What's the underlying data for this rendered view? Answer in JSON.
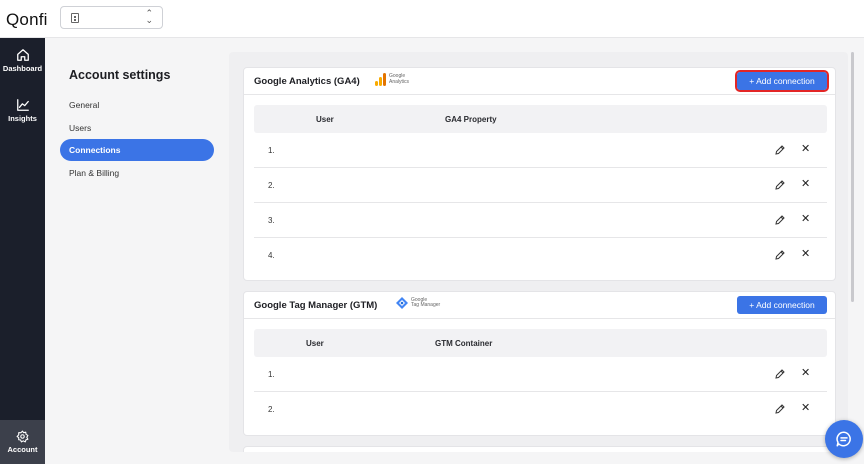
{
  "app": {
    "logo": "Qonfi"
  },
  "workspace_select": {
    "value": ""
  },
  "leftnav": {
    "items": [
      {
        "label": "Dashboard",
        "icon": "home-icon"
      },
      {
        "label": "Insights",
        "icon": "chart-line-icon"
      },
      {
        "label": "Account",
        "icon": "gear-icon",
        "active": true
      }
    ]
  },
  "settings": {
    "title": "Account settings",
    "items": [
      {
        "label": "General"
      },
      {
        "label": "Users"
      },
      {
        "label": "Connections",
        "active": true
      },
      {
        "label": "Plan & Billing"
      }
    ]
  },
  "ga4": {
    "title": "Google Analytics (GA4)",
    "brand_line1": "Google",
    "brand_line2": "Analytics",
    "add_label": "+ Add connection",
    "columns": [
      "User",
      "GA4 Property"
    ],
    "rows": [
      "1.",
      "2.",
      "3.",
      "4."
    ]
  },
  "gtm": {
    "title": "Google Tag Manager (GTM)",
    "brand_line1": "Google",
    "brand_line2": "Tag Manager",
    "add_label": "+ Add connection",
    "columns": [
      "User",
      "GTM Container"
    ],
    "rows": [
      "1.",
      "2."
    ]
  },
  "colors": {
    "accent": "#3b74e6",
    "sidebar": "#1b1f2b",
    "highlight": "#e32626"
  }
}
